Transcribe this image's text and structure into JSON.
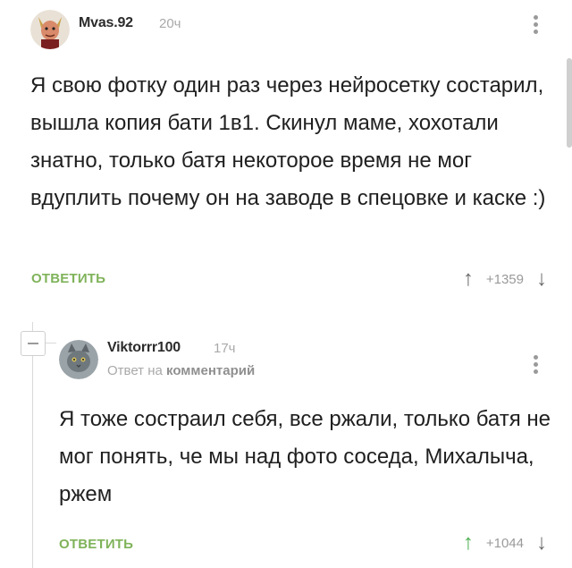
{
  "comments": [
    {
      "author": "Mvas.92",
      "time": "20ч",
      "text": "Я свою фотку один раз через нейросетку состарил, вышла копия бати 1в1. Скинул маме, хохотали знатно, только батя некоторое время не мог вдуплить почему он на заводе в спецовке и каске :)",
      "reply_label": "ОТВЕТИТЬ",
      "votes": "+1359",
      "avatar_icon": "devil-avatar"
    },
    {
      "author": "Viktorrr100",
      "time": "17ч",
      "reply_to_prefix": "Ответ на",
      "reply_to_link": "комментарий",
      "text": "Я тоже состраил себя, все ржали, только батя не мог понять, че мы над фото соседа, Михалыча, ржем",
      "reply_label": "ОТВЕТИТЬ",
      "votes": "+1044",
      "avatar_icon": "cat-avatar"
    }
  ],
  "colors": {
    "reply": "#7fb35a",
    "upvoted": "#4caf50",
    "muted": "#a9a9a9"
  }
}
